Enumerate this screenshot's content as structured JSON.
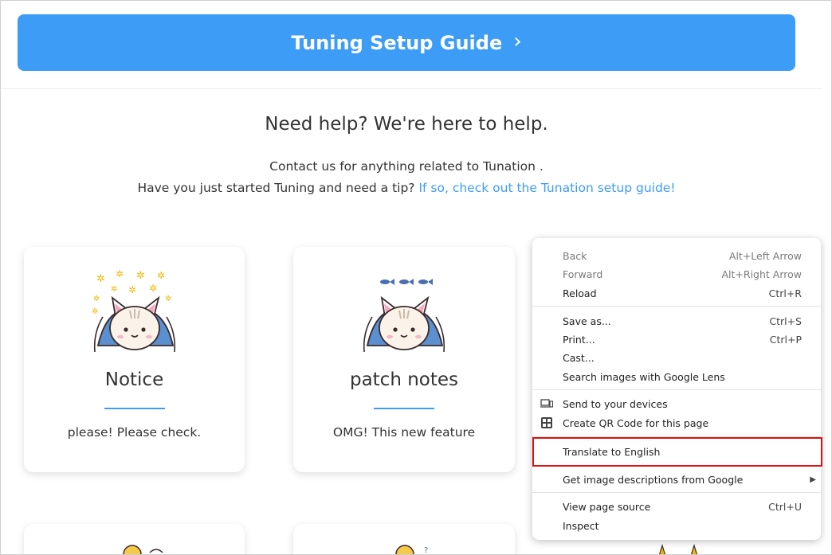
{
  "banner": {
    "label": "Tuning Setup Guide",
    "chevron": "›"
  },
  "help": {
    "title": "Need help? We're here to help.",
    "line1": "Contact us for anything related to Tunation .",
    "line2_prefix": "Have you just started Tuning and need a tip? ",
    "line2_link": "If so, check out the Tunation setup guide!"
  },
  "cards": [
    {
      "title": "Notice",
      "desc": "please! Please check.",
      "icon": "cat-mascot-sparkle-icon"
    },
    {
      "title": "patch notes",
      "desc": "OMG! This new feature",
      "icon": "cat-mascot-fish-icon"
    }
  ],
  "context_menu": {
    "items": [
      {
        "label": "Back",
        "shortcut": "Alt+Left Arrow",
        "disabled": true
      },
      {
        "label": "Forward",
        "shortcut": "Alt+Right Arrow",
        "disabled": true
      },
      {
        "label": "Reload",
        "shortcut": "Ctrl+R"
      },
      {
        "label": "Save as...",
        "shortcut": "Ctrl+S"
      },
      {
        "label": "Print...",
        "shortcut": "Ctrl+P"
      },
      {
        "label": "Cast..."
      },
      {
        "label": "Search images with Google Lens"
      },
      {
        "label": "Send to your devices",
        "icon": "devices-icon"
      },
      {
        "label": "Create QR Code for this page",
        "icon": "qr-code-icon"
      },
      {
        "label": "Translate to English"
      },
      {
        "label": "Get image descriptions from Google",
        "submenu": true
      },
      {
        "label": "View page source",
        "shortcut": "Ctrl+U"
      },
      {
        "label": "Inspect"
      }
    ]
  },
  "colors": {
    "accent": "#3d9df6",
    "highlight_border": "#e01010"
  }
}
